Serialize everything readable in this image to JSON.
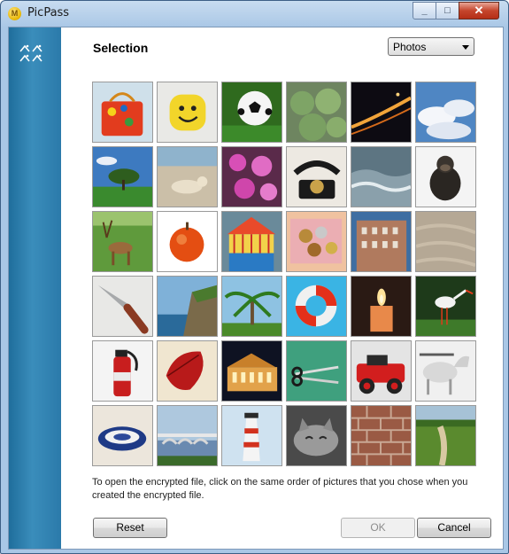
{
  "window": {
    "title": "PicPass",
    "min": "_",
    "max": "□",
    "close": "✕"
  },
  "main": {
    "heading": "Selection",
    "category": "Photos"
  },
  "tiles": [
    "tile-bag",
    "tile-smiley-ball",
    "tile-soccer-ball",
    "tile-cactus",
    "tile-night-road",
    "tile-clouds",
    "tile-tree",
    "tile-dog-beach",
    "tile-pink-flowers",
    "tile-phone",
    "tile-waves",
    "tile-monkey",
    "tile-deer",
    "tile-apple",
    "tile-carousel",
    "tile-coins",
    "tile-building",
    "tile-sand",
    "tile-knife",
    "tile-coast",
    "tile-palm",
    "tile-lifebuoy",
    "tile-candle",
    "tile-stork",
    "tile-extinguisher",
    "tile-leaf",
    "tile-opera-house",
    "tile-scissors",
    "tile-red-car",
    "tile-horse",
    "tile-bowl",
    "tile-bridge",
    "tile-lighthouse",
    "tile-cat",
    "tile-brick-wall",
    "tile-path"
  ],
  "instructions": "To open the encrypted file, click on the same order of pictures that you chose when you created the encrypted file.",
  "buttons": {
    "reset": "Reset",
    "ok": "OK",
    "cancel": "Cancel"
  },
  "colors": {
    "sidebar": "#2b7aaa",
    "titlebar": "#a9c7e6"
  }
}
